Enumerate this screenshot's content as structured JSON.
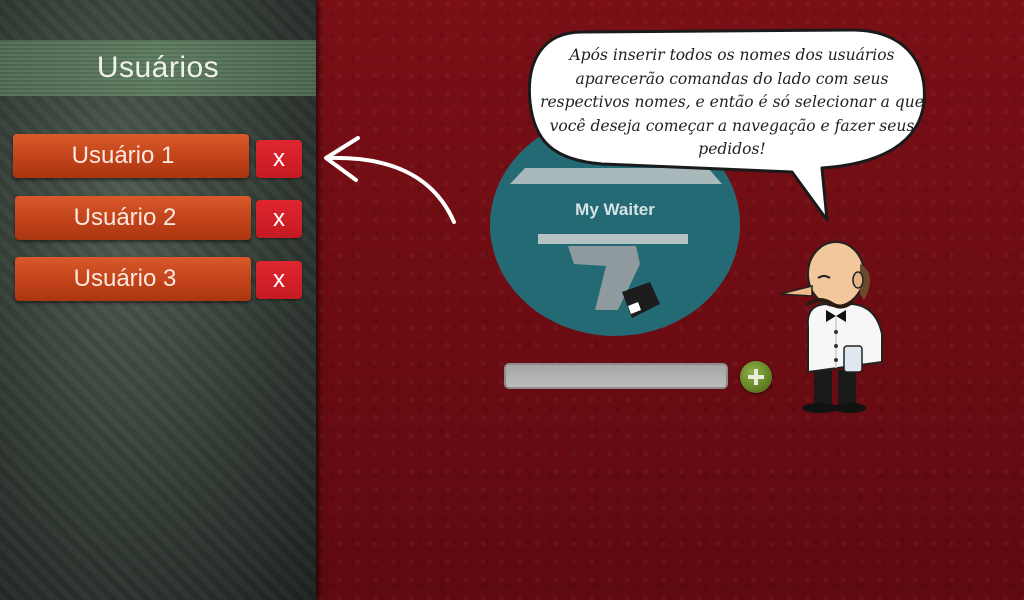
{
  "sidebar": {
    "title": "Usuários",
    "users": [
      {
        "label": "Usuário 1",
        "delete_label": "x"
      },
      {
        "label": "Usuário 2",
        "delete_label": "x"
      },
      {
        "label": "Usuário 3",
        "delete_label": "x"
      }
    ]
  },
  "logo": {
    "text": "My Waiter"
  },
  "speech_bubble": {
    "text": "Após inserir todos os nomes dos usuários aparecerão comandas do lado com seus respectivos nomes, e então é só selecionar a que você deseja começar a navegação e fazer seus pedidos!"
  },
  "name_input": {
    "value": "",
    "placeholder": ""
  },
  "icons": {
    "add": "plus-circle-icon",
    "arrow": "curved-arrow-left-icon",
    "waiter": "waiter-character"
  },
  "colors": {
    "user_button": "#c2421a",
    "delete_button": "#d11f28",
    "logo_circle": "#236a74",
    "background": "#6e0d12"
  }
}
